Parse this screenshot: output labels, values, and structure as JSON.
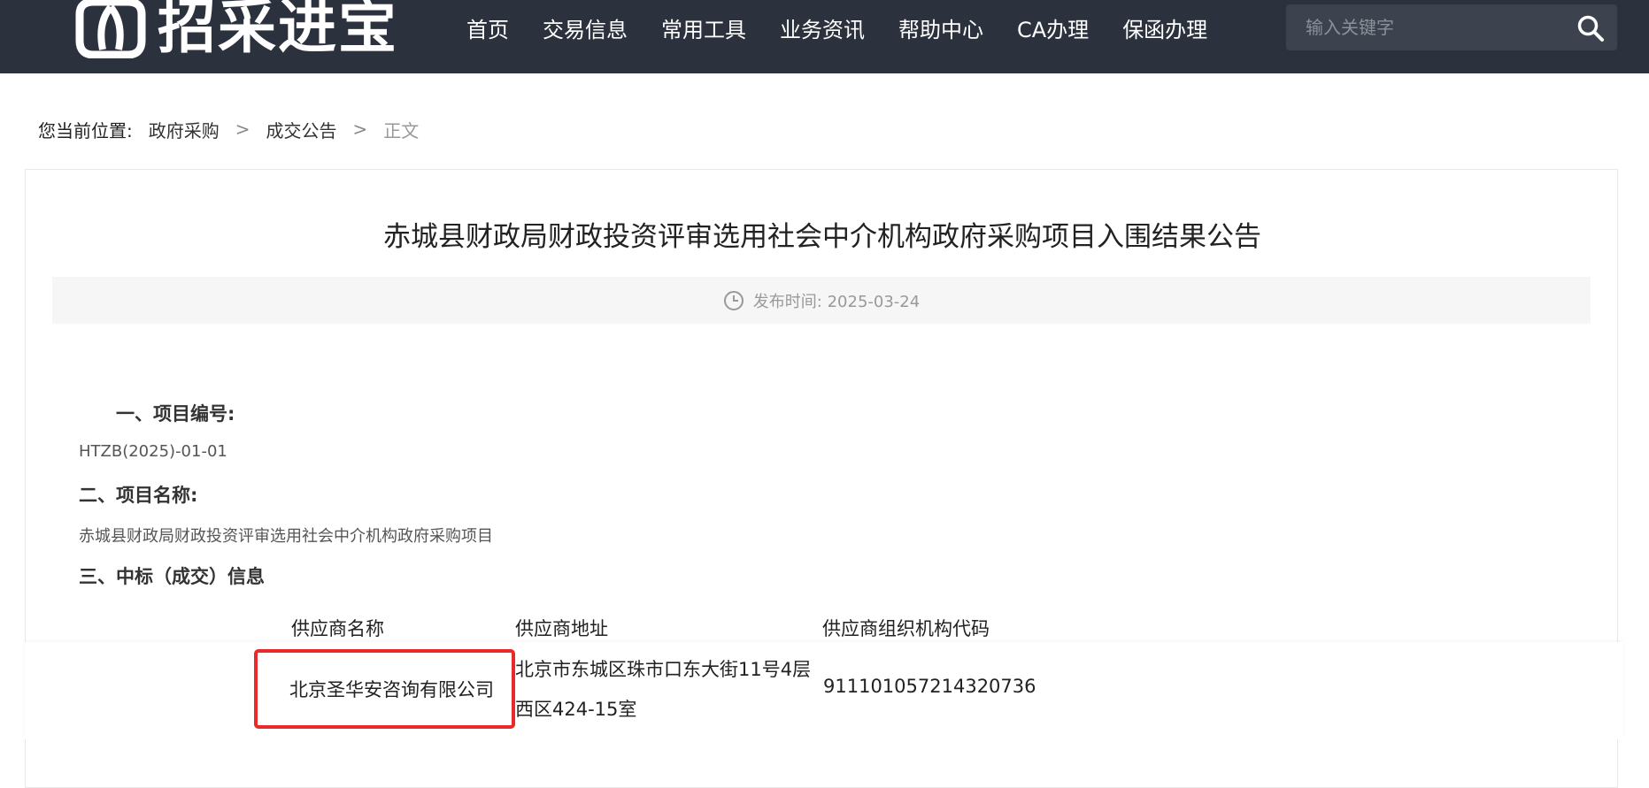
{
  "header": {
    "logo_text": "招采进宝",
    "nav": [
      "首页",
      "交易信息",
      "常用工具",
      "业务资讯",
      "帮助中心",
      "CA办理",
      "保函办理"
    ],
    "search_placeholder": "输入关键字",
    "search_icon": "search-icon"
  },
  "breadcrumb": {
    "label": "您当前位置:",
    "items": [
      "政府采购",
      "成交公告"
    ],
    "separator": ">",
    "current": "正文"
  },
  "article": {
    "title": "赤城县财政局财政投资评审选用社会中介机构政府采购项目入围结果公告",
    "publish_time": "发布时间: 2025-03-24",
    "sections": {
      "s1_title": "一、项目编号:",
      "s1_body": "HTZB(2025)-01-01",
      "s2_title": "二、项目名称:",
      "s2_body": "赤城县财政局财政投资评审选用社会中介机构政府采购项目",
      "s3_title": "三、中标（成交）信息"
    },
    "table": {
      "headers": [
        "供应商名称",
        "供应商地址",
        "供应商组织机构代码"
      ],
      "rows": [
        {
          "name": "北京圣华安咨询有限公司",
          "address_line1": "北京市东城区珠市口东大街11号4层",
          "address_line2": "西区424-15室",
          "code": "911101057214320736"
        }
      ]
    }
  },
  "colors": {
    "header_bg": "#2c323d",
    "highlight_border": "#e82a2a",
    "meta_bg": "#f6f6f6"
  }
}
